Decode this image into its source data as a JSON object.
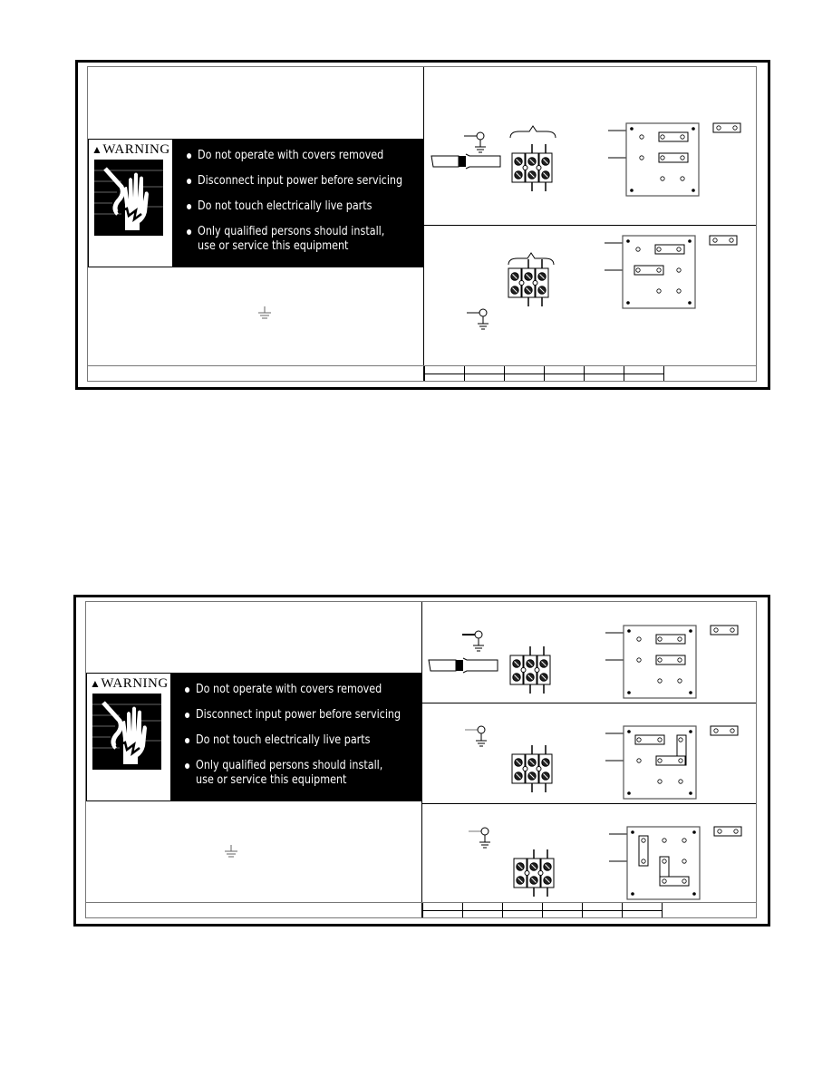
{
  "document": {
    "panels": [
      {
        "id": "top",
        "warning": {
          "title": "WARNING",
          "icon": "electric-shock-hand-icon",
          "items": [
            "Do  not operate  with  covers removed",
            "Disconnect input power before  servicing",
            "Do  not touch  electrically  live  parts",
            "Only  qualified  persons should  install,",
            "use  or service  this equipment"
          ]
        },
        "ground_symbol": "ground-icon",
        "diagrams": [
          {
            "name": "configuration-1",
            "cable": true,
            "jumpers": "horizontal-pair"
          },
          {
            "name": "configuration-2",
            "cable": false,
            "jumpers": "offset-pair"
          }
        ],
        "title_block_cells": 6
      },
      {
        "id": "bottom",
        "warning": {
          "title": "WARNING",
          "icon": "electric-shock-hand-icon",
          "items": [
            "Do  not operate  with  covers removed",
            "Disconnect input power before  servicing",
            "Do  not touch  electrically  live  parts",
            "Only  qualified  persons should  install,",
            "use  or service  this equipment"
          ]
        },
        "ground_symbol": "ground-icon",
        "diagrams": [
          {
            "name": "configuration-1",
            "cable": true,
            "jumpers": "horizontal-pair"
          },
          {
            "name": "configuration-2",
            "cable": false,
            "jumpers": "l-shape-top"
          },
          {
            "name": "configuration-3",
            "cable": false,
            "jumpers": "l-shape-vertical"
          }
        ],
        "title_block_cells": 6
      }
    ],
    "colors": {
      "ink": "#000000",
      "paper": "#ffffff",
      "line_gray": "#777777"
    }
  }
}
